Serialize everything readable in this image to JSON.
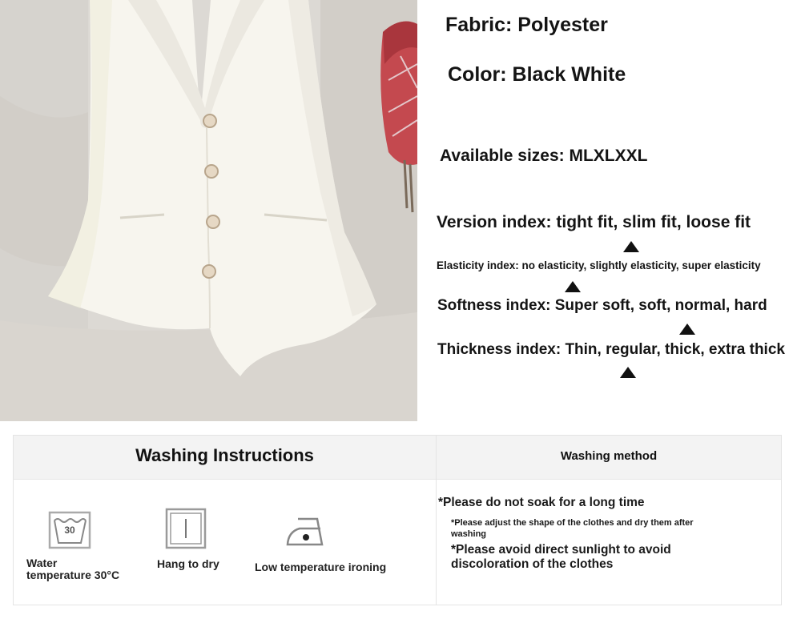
{
  "specs": {
    "fabric": "Fabric: Polyester",
    "color": "Color: Black White",
    "sizes": "Available sizes: MLXLXXL",
    "version_index": "Version index: tight fit, slim fit, loose fit",
    "elasticity_index": "Elasticity index: no elasticity, slightly elasticity, super elasticity",
    "softness_index": "Softness index: Super soft, soft, normal, hard",
    "thickness_index": "Thickness index: Thin, regular, thick, extra thick"
  },
  "washing": {
    "instructions_title": "Washing Instructions",
    "method_title": "Washing method",
    "care_icons": [
      {
        "icon": "wash-30-icon",
        "label_line1": "Water",
        "label_line2": "temperature 30°C",
        "tub_text": "30"
      },
      {
        "icon": "hang-dry-icon",
        "label": "Hang to dry"
      },
      {
        "icon": "iron-low-icon",
        "label": "Low temperature ironing"
      }
    ],
    "notes": [
      "*Please do not soak for a long time",
      "*Please adjust the shape of the clothes and dry them after washing",
      "*Please avoid direct sunlight to avoid discoloration of the clothes"
    ]
  },
  "colors": {
    "vest": "#f7f5ee",
    "background_fabric": "#dcd9d4",
    "bag": "#c4494f",
    "text": "#141414"
  }
}
